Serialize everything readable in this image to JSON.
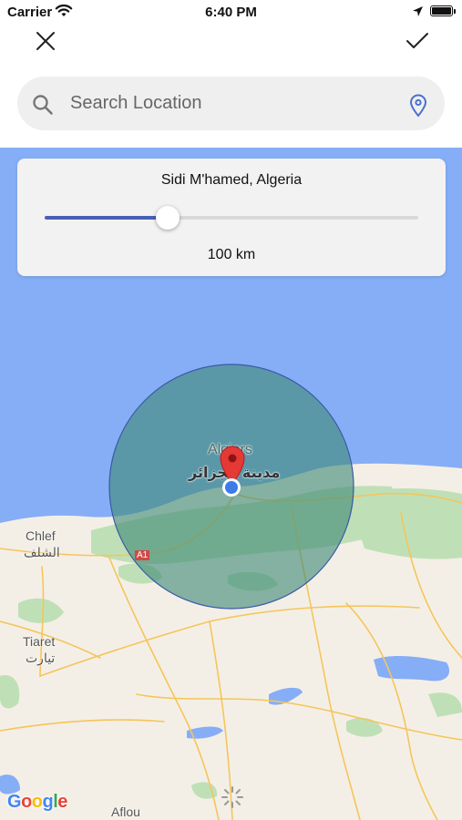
{
  "status_bar": {
    "carrier": "Carrier",
    "time": "6:40 PM"
  },
  "nav": {
    "close_icon": "close-icon",
    "confirm_icon": "checkmark-icon"
  },
  "search": {
    "placeholder": "Search Location",
    "value": ""
  },
  "radius_card": {
    "location": "Sidi M'hamed, Algeria",
    "distance_label": "100 km",
    "slider_fraction": 0.33
  },
  "map": {
    "labels": {
      "city_main": "Algiers",
      "city_main_ar": "مدينة الجزائر",
      "city_west": "Chlef",
      "city_west_ar": "الشلف",
      "city_southwest": "Tiaret",
      "city_southwest_ar": "تيارت",
      "city_south": "Aflou",
      "highway": "A1"
    },
    "colors": {
      "water": "#86aef6",
      "land": "#f4efe6",
      "radius_fill": "#3f8a78",
      "pin": "#e53935",
      "location_dot": "#3d7be8"
    }
  },
  "google_logo": {
    "G": "G",
    "o1": "o",
    "o2": "o",
    "g": "g",
    "l": "l",
    "e": "e"
  }
}
